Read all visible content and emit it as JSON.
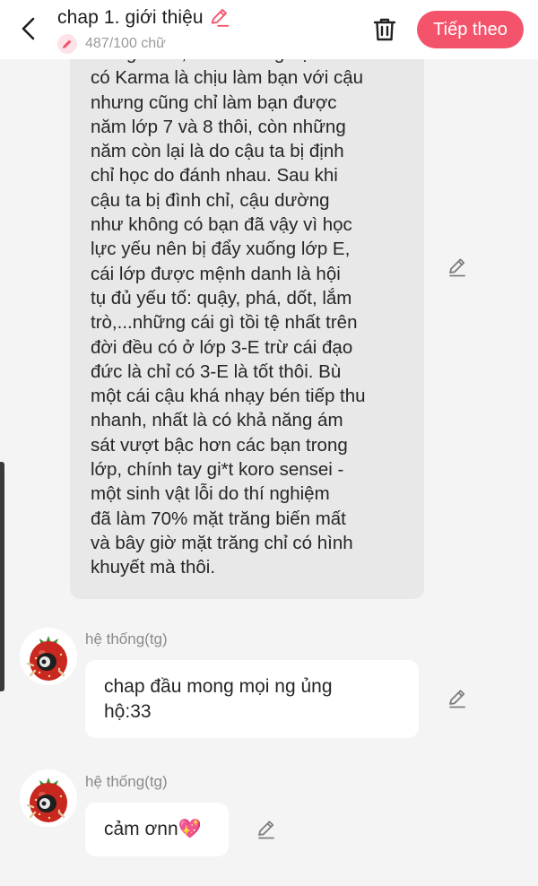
{
  "header": {
    "title": "chap 1. giới thiệu",
    "word_count": "487/100 chữ",
    "next_label": "Tiếp theo"
  },
  "messages": [
    {
      "lines": [
        "thông minh, trên trường học chỉ",
        "có Karma là chịu làm bạn với cậu",
        "nhưng cũng chỉ làm bạn được",
        "năm lớp 7 và 8 thôi, còn những",
        "năm còn lại là do cậu ta bị định",
        "chỉ học do đánh nhau. Sau khi",
        "cậu ta bị đình chỉ, cậu dường",
        "như không có bạn đã vậy vì học",
        "lực yếu nên bị đẩy xuống lớp E,",
        "cái lớp được mệnh danh là hội",
        "tụ đủ yếu tố: quậy, phá, dốt, lắm",
        "trò,...những cái gì tồi tệ nhất trên",
        "đời đều có ở lớp 3-E trừ cái đạo",
        "đức là chỉ có 3-E là tốt thôi. Bù",
        "một cái cậu khá nhạy bén tiếp thu",
        "nhanh, nhất là có khả năng ám",
        "sát vượt bậc hơn các bạn trong",
        "lớp, chính tay gi*t koro sensei -",
        "một sinh vật lỗi do thí nghiệm",
        "đã làm 70% mặt trăng biến mất",
        "và bây giờ mặt trăng chỉ có hình",
        "khuyết mà thôi."
      ]
    },
    {
      "sender": "hệ thống(tg)",
      "lines": [
        "chap đầu mong mọi ng ủng",
        "hộ:33"
      ]
    },
    {
      "sender": "hệ thống(tg)",
      "lines": [
        "cảm ơnn💖"
      ]
    }
  ],
  "colors": {
    "accent": "#f4546b",
    "bubble_gray": "#e8e8e8",
    "bubble_white": "#ffffff",
    "background": "#f4f4f4"
  },
  "icons": [
    "back-arrow-icon",
    "pencil-icon",
    "trash-icon",
    "strawberry-avatar"
  ]
}
